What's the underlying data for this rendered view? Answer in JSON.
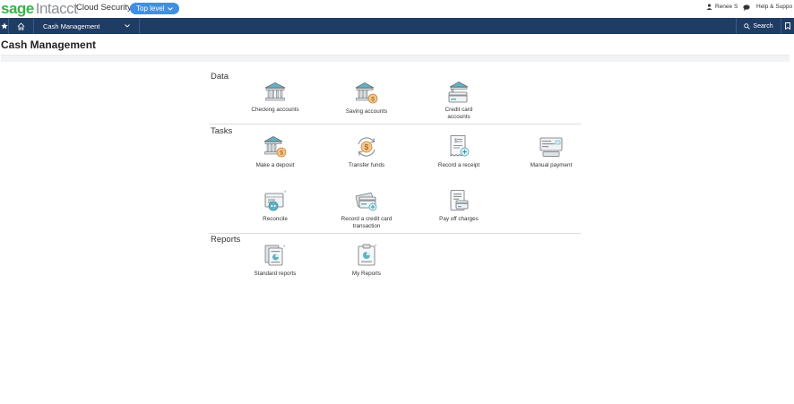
{
  "topbar": {
    "logo_sage": "sage",
    "logo_intacct": "Intacct",
    "company": "Cloud Security",
    "level": "Top level",
    "user": "Renee S",
    "help": "Help & Suppo"
  },
  "navbar": {
    "app": "Cash Management",
    "search": "Search"
  },
  "page": {
    "title": "Cash Management"
  },
  "sections": {
    "data": {
      "label": "Data",
      "items": [
        "Checking accounts",
        "Saving accounts",
        "Credit card accounts"
      ]
    },
    "tasks": {
      "label": "Tasks",
      "items": [
        "Make a deposit",
        "Transfer funds",
        "Record a receipt",
        "Manual payment",
        "Reconcile",
        "Record a credit card transaction",
        "Pay off charges"
      ]
    },
    "reports": {
      "label": "Reports",
      "items": [
        "Standard reports",
        "My Reports"
      ]
    }
  },
  "colors": {
    "navbar": "#1f3c64",
    "pill": "#3f8ee8",
    "brand_green": "#37b34a",
    "icon_teal": "#5fb3c4",
    "icon_orange": "#e9a54a",
    "icon_gray": "#8f9499"
  },
  "icons": {
    "star": "star-icon",
    "home": "home-icon",
    "user": "user-icon",
    "chat": "chat-icon",
    "search": "search-icon",
    "bookmark": "bookmark-icon"
  }
}
